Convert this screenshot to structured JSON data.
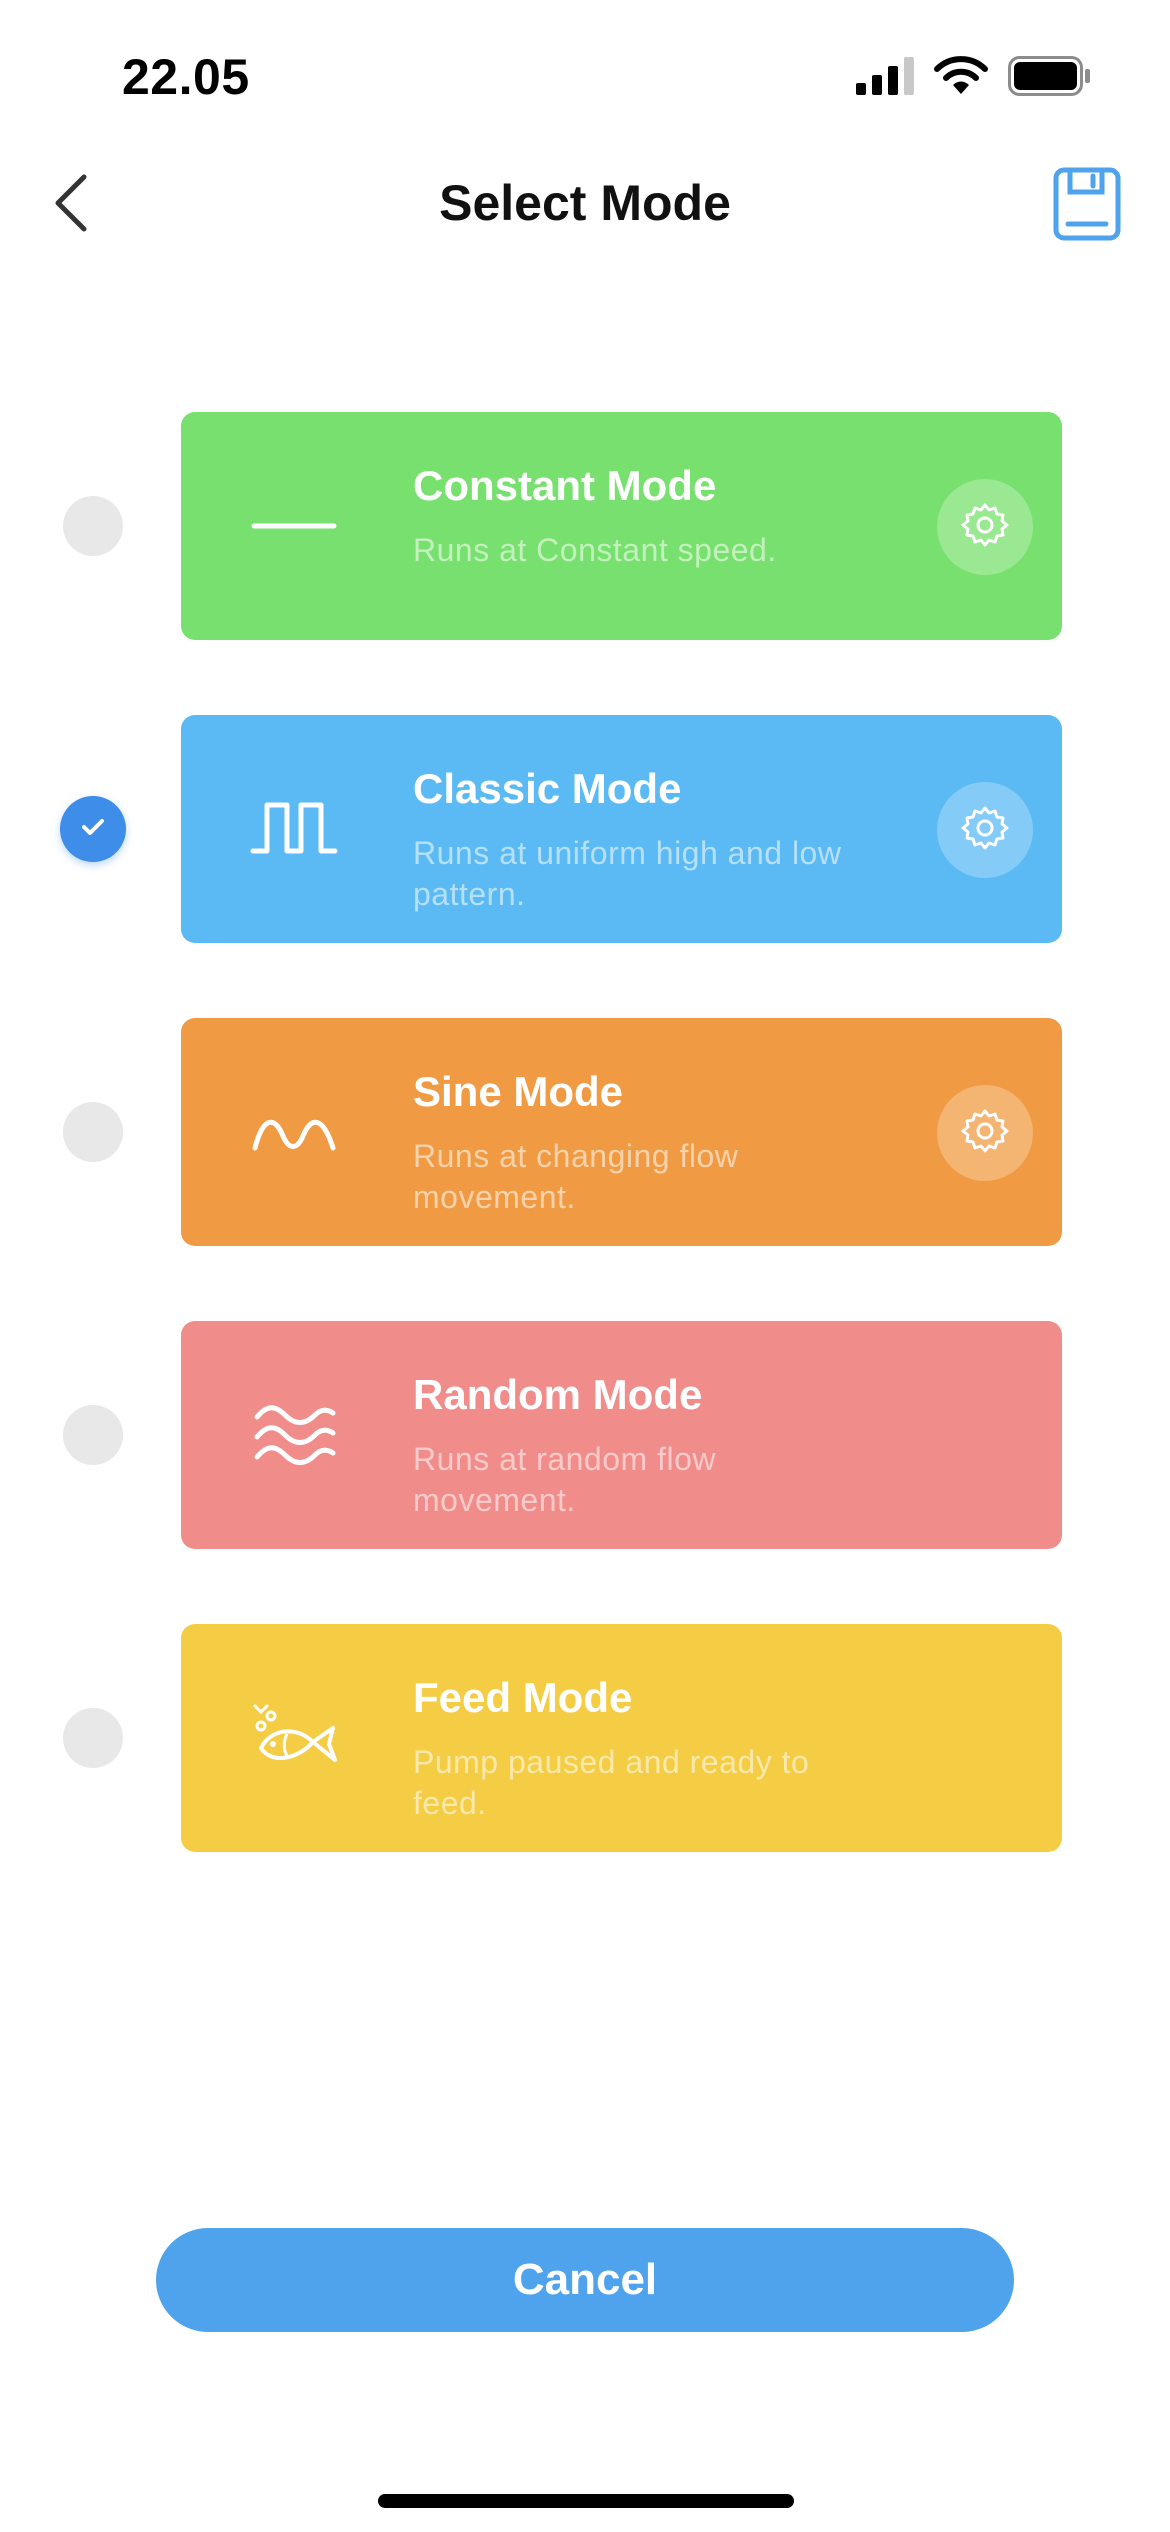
{
  "status": {
    "time": "22.05"
  },
  "nav": {
    "title": "Select Mode",
    "back_icon": "chevron-left-icon",
    "save_icon": "floppy-disk-icon"
  },
  "modes": [
    {
      "title": "Constant Mode",
      "description": "Runs at Constant speed.",
      "color": "#78e06e",
      "icon": "constant-line-icon",
      "selected": false,
      "has_settings": true
    },
    {
      "title": "Classic Mode",
      "description": "Runs at uniform high and low pattern.",
      "color": "#5bbaf4",
      "icon": "square-wave-icon",
      "selected": true,
      "has_settings": true
    },
    {
      "title": "Sine Mode",
      "description": "Runs at changing flow movement.",
      "color": "#f09b43",
      "icon": "sine-wave-icon",
      "selected": false,
      "has_settings": true
    },
    {
      "title": "Random Mode",
      "description": "Runs at random flow movement.",
      "color": "#f08c8a",
      "icon": "random-waves-icon",
      "selected": false,
      "has_settings": false
    },
    {
      "title": "Feed Mode",
      "description": "Pump paused and ready to feed.",
      "color": "#f5cd45",
      "icon": "fish-icon",
      "selected": false,
      "has_settings": false
    }
  ],
  "cancel_label": "Cancel",
  "theme": {
    "accent": "#4ea3ec",
    "radio_selected": "#3d8de9",
    "radio_unselected": "#e8e8e8"
  }
}
